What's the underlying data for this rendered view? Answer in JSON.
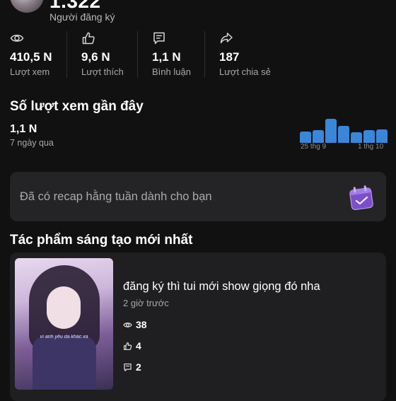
{
  "profile": {
    "subscriber_count_partial": "1.322",
    "subscriber_label": "Người đăng ký"
  },
  "stats": [
    {
      "icon": "eye-icon",
      "value": "410,5 N",
      "label": "Lượt xem"
    },
    {
      "icon": "thumbs-up-icon",
      "value": "9,6 N",
      "label": "Lượt thích"
    },
    {
      "icon": "comment-icon",
      "value": "1,1 N",
      "label": "Bình luận"
    },
    {
      "icon": "share-icon",
      "value": "187",
      "label": "Lượt chia sẻ"
    }
  ],
  "recent_views": {
    "title": "Số lượt xem gần đây",
    "value": "1,1 N",
    "period": "7 ngày qua",
    "axis_start": "25 thg 9",
    "axis_end": "1 thg 10",
    "chart_data": {
      "type": "bar",
      "values": [
        13,
        15,
        28,
        20,
        12,
        15,
        16
      ],
      "color": "#3a87d9"
    }
  },
  "recap": {
    "text": "Đã có recap hằng tuần dành cho bạn",
    "icon": "calendar-icon",
    "icon_color": "#8a5bd6"
  },
  "latest": {
    "title": "Tác phẩm sáng tạo mới nhất",
    "post": {
      "caption": "đăng ký thì tui mới show giọng đó nha",
      "time": "2 giờ trước",
      "thumbnail_overlay_text": "vì anh yêu da khác xa",
      "views": "38",
      "likes": "4",
      "comments": "2"
    }
  }
}
